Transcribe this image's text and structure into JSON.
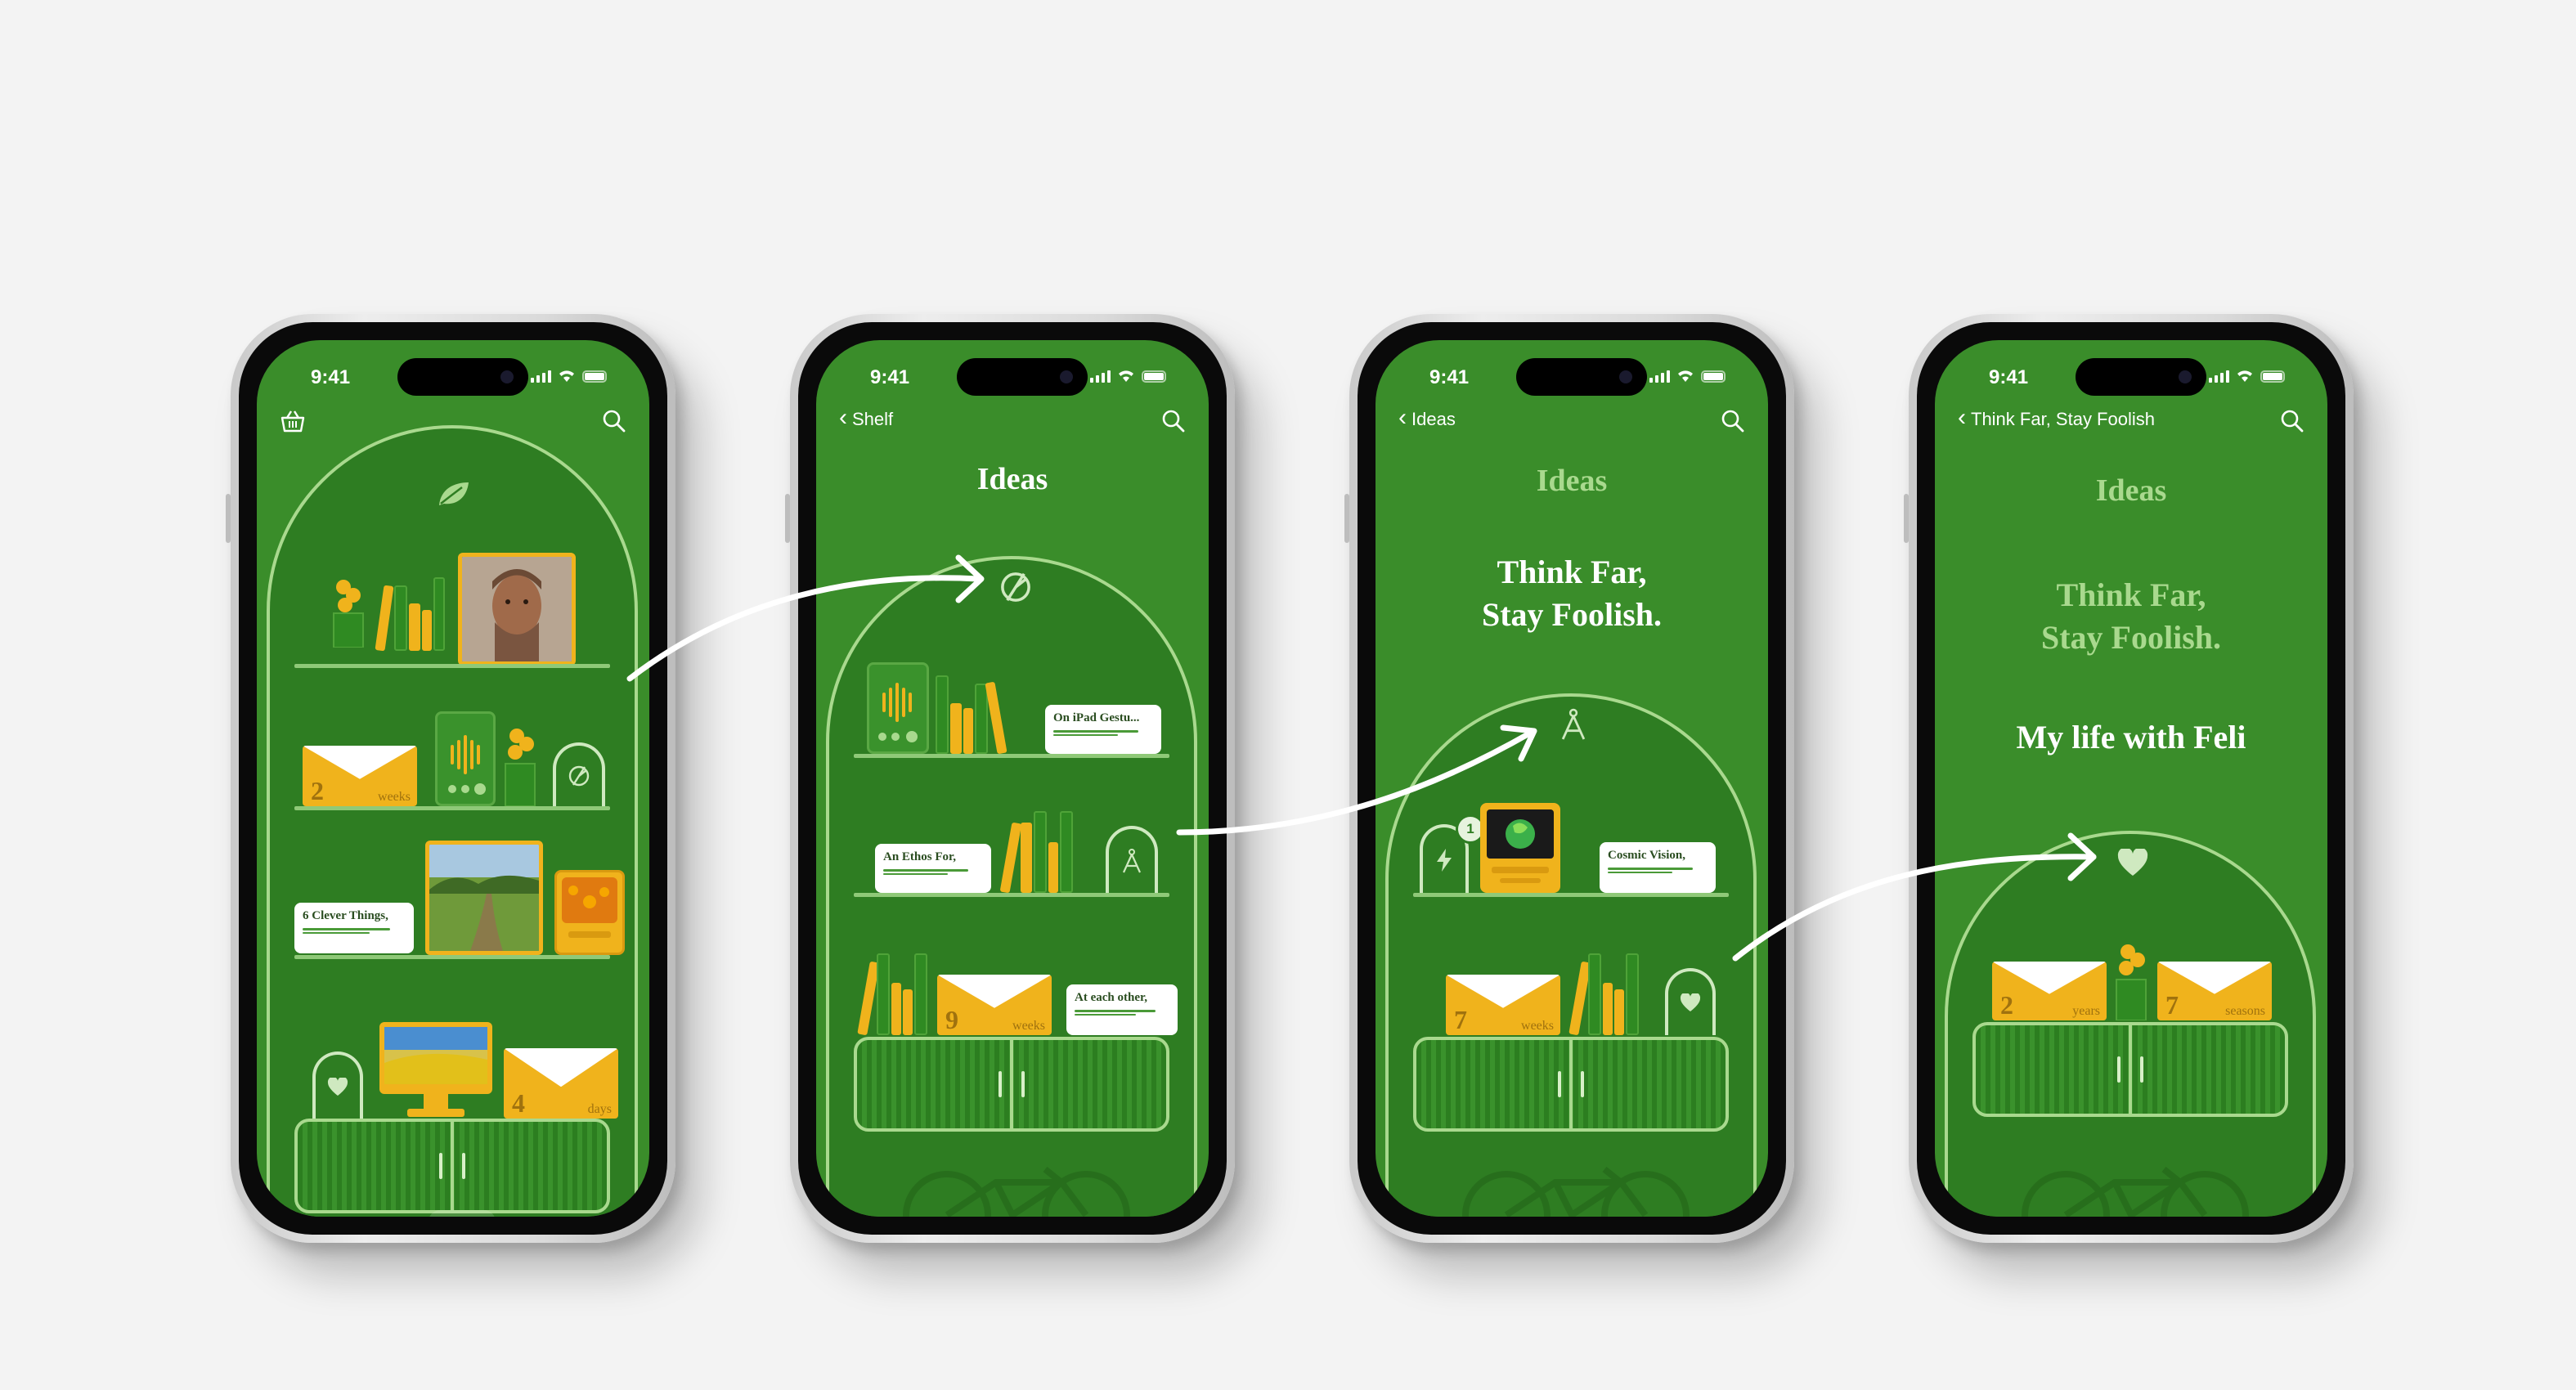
{
  "status_bar": {
    "time": "9:41"
  },
  "screens": [
    {
      "id": "shelf",
      "bottom_shelf": {
        "envelope_number": "4",
        "envelope_unit": "days"
      },
      "mid_shelf": {
        "envelope_number": "2",
        "envelope_unit": "weeks"
      },
      "card": {
        "title": "6 Clever Things,"
      },
      "pager": {
        "pages": 3,
        "current": 1
      }
    },
    {
      "id": "ideas",
      "back_label": "Shelf",
      "title": "Ideas",
      "cards": [
        "On iPad Gestu...",
        "An Ethos For,",
        "At each other,"
      ],
      "envelope": {
        "number": "9",
        "unit": "weeks"
      }
    },
    {
      "id": "think-far",
      "back_label": "Ideas",
      "parent_title": "Ideas",
      "title": "Think Far,\nStay Foolish.",
      "card": "Cosmic Vision,",
      "badge": "1",
      "envelope": {
        "number": "7",
        "unit": "weeks"
      }
    },
    {
      "id": "my-life",
      "back_label": "Think Far, Stay Foolish",
      "parent_title": "Ideas",
      "parent_subtitle": "Think Far,\nStay Foolish.",
      "title": "My life with Feli",
      "envelopes": [
        {
          "number": "2",
          "unit": "years"
        },
        {
          "number": "7",
          "unit": "seasons"
        }
      ]
    }
  ],
  "colors": {
    "screen_bg": "#3a8d2a",
    "accent_yellow": "#f0b31c",
    "outline": "#a9d98e"
  }
}
